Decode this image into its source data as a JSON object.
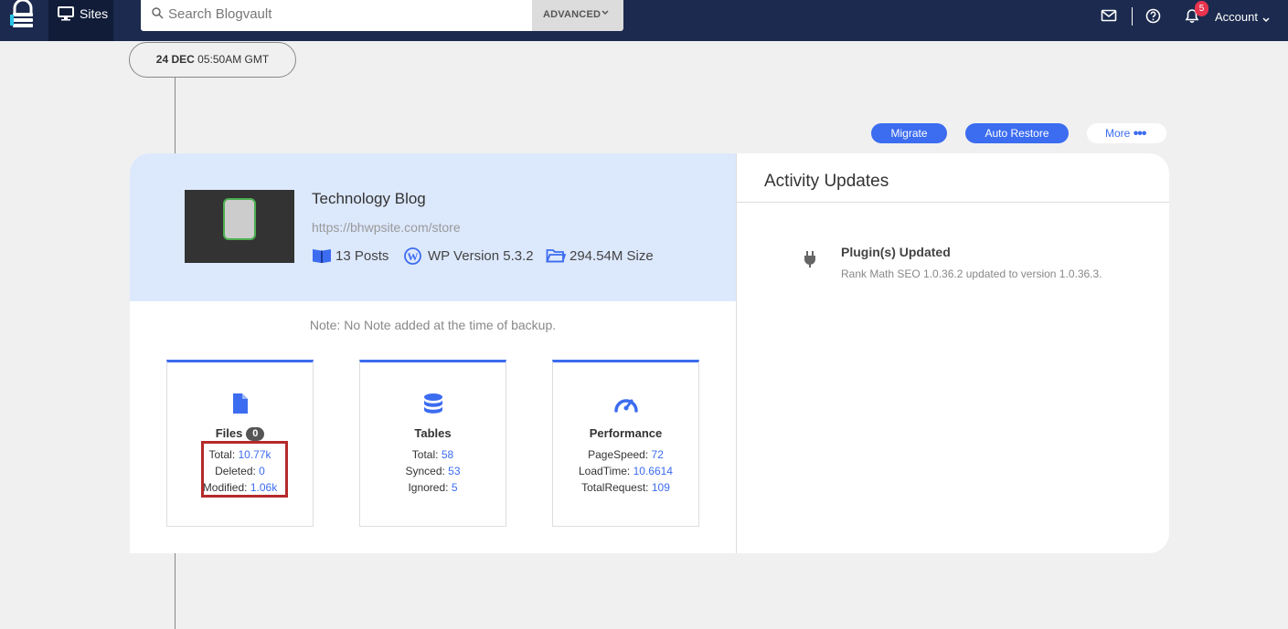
{
  "nav": {
    "sites_label": "Sites",
    "search_placeholder": "Search Blogvault",
    "advanced_label": "ADVANCED",
    "notification_count": "5",
    "account_label": "Account"
  },
  "timeline": {
    "date_bold": "24 DEC",
    "time": "05:50AM GMT"
  },
  "actions": {
    "migrate": "Migrate",
    "auto_restore": "Auto Restore",
    "more": "More"
  },
  "site": {
    "title": "Technology Blog",
    "url": "https://bhwpsite.com/store",
    "posts": "13 Posts",
    "wp_version": "WP Version 5.3.2",
    "size": "294.54M Size",
    "note": "Note: No Note added at the time of backup."
  },
  "stats": {
    "files": {
      "title": "Files",
      "badge": "0",
      "total_label": "Total:",
      "total": "10.77k",
      "deleted_label": "Deleted:",
      "deleted": "0",
      "modified_label": "Modified:",
      "modified": "1.06k"
    },
    "tables": {
      "title": "Tables",
      "total_label": "Total:",
      "total": "58",
      "synced_label": "Synced:",
      "synced": "53",
      "ignored_label": "Ignored:",
      "ignored": "5"
    },
    "performance": {
      "title": "Performance",
      "pagespeed_label": "PageSpeed:",
      "pagespeed": "72",
      "loadtime_label": "LoadTime:",
      "loadtime": "10.6614",
      "totalrequest_label": "TotalRequest:",
      "totalrequest": "109"
    }
  },
  "activity": {
    "title": "Activity Updates",
    "items": [
      {
        "icon": "plug-icon",
        "heading": "Plugin(s) Updated",
        "description": "Rank Math SEO 1.0.36.2 updated to version 1.0.36.3."
      }
    ]
  },
  "colors": {
    "nav_bg": "#1b2a4e",
    "accent": "#3c6cf0",
    "header_bg": "#dce8fc",
    "highlight_border": "#b52a2a"
  }
}
